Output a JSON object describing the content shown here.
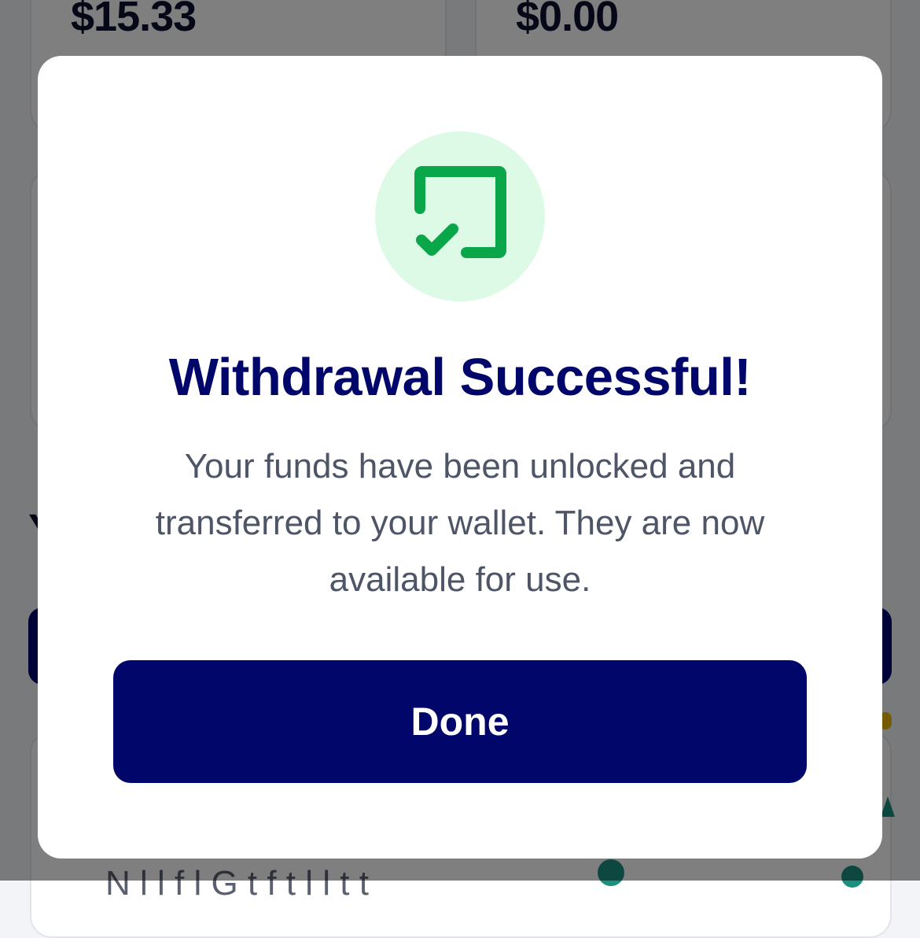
{
  "background": {
    "balance_left": "$15.33",
    "balance_right": "$0.00",
    "section_letter": "Y",
    "subtext_partial": "N l l f  l G  t     f t l l t  t"
  },
  "modal": {
    "icon": "check-square-icon",
    "title": "Withdrawal Successful!",
    "message": "Your funds have been unlocked and transferred to your wallet. They are now available for use.",
    "done_label": "Done"
  },
  "colors": {
    "primary_navy": "#00066a",
    "success_green": "#0aa64a",
    "success_bg": "#dcfae5",
    "body_text": "#4d5566",
    "overlay": "rgba(0,0,0,0.5)"
  }
}
